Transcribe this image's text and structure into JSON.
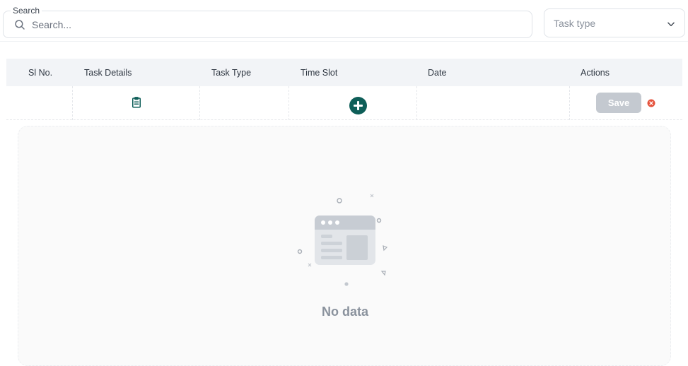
{
  "search": {
    "label": "Search",
    "placeholder": "Search...",
    "value": ""
  },
  "filter": {
    "task_type_label": "Task type"
  },
  "table": {
    "columns": [
      "Sl No.",
      "Task Details",
      "Task Type",
      "Time Slot",
      "Date",
      "Actions"
    ],
    "new_row": {
      "save_label": "Save"
    }
  },
  "empty_state": {
    "message": "No data"
  },
  "icons": {
    "search": "search-icon",
    "dropdown": "chevron-down-icon",
    "task_details": "clipboard-icon",
    "add_time_slot": "plus-circle-icon",
    "cancel": "close-circle-icon",
    "empty": "empty-window-illustration"
  },
  "colors": {
    "accent": "#0e5e58",
    "save_disabled": "#c4c9d0",
    "cancel": "#e5533d",
    "header_bg": "#f2f4f7"
  }
}
